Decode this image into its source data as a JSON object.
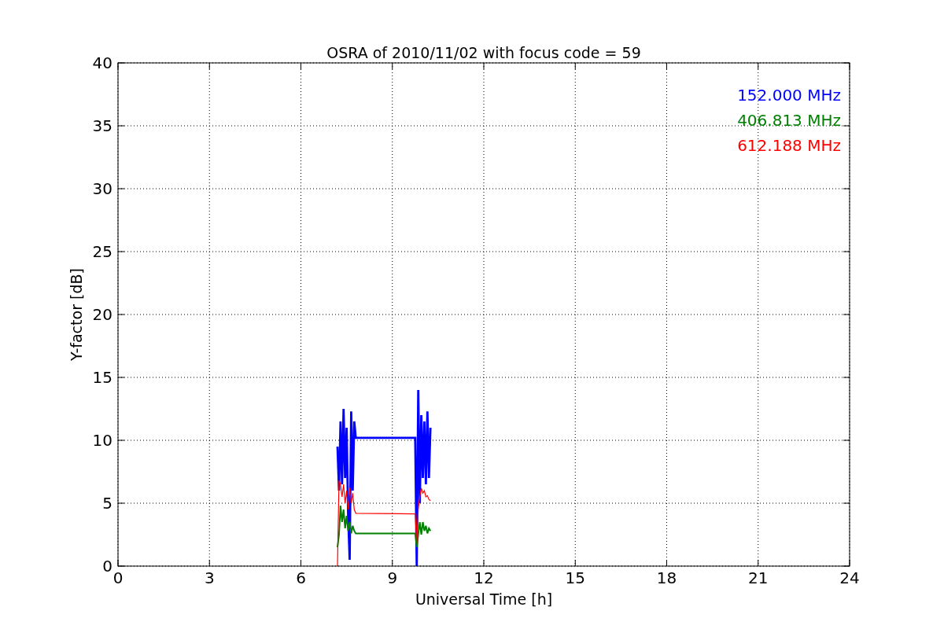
{
  "chart_data": {
    "type": "line",
    "title": "OSRA of 2010/11/02 with focus code = 59",
    "xlabel": "Universal Time [h]",
    "ylabel": "Y-factor [dB]",
    "x": [
      7.2,
      7.25,
      7.3,
      7.35,
      7.4,
      7.45,
      7.5,
      7.55,
      7.6,
      7.65,
      7.7,
      7.75,
      7.8,
      9.75,
      9.8,
      9.85,
      9.9,
      9.95,
      10.0,
      10.05,
      10.1,
      10.15,
      10.2,
      10.25
    ],
    "series": [
      {
        "name": "152.000 MHz",
        "color": "#0000ff",
        "values": [
          9.5,
          6,
          11.5,
          6.5,
          12.5,
          7,
          11,
          4,
          0.5,
          12.3,
          6,
          11.5,
          10.2,
          10.2,
          0,
          14,
          5,
          12,
          7,
          11.5,
          6.5,
          12.3,
          7,
          11
        ]
      },
      {
        "name": "406.813 MHz",
        "color": "#008000",
        "values": [
          1.5,
          2.5,
          4.8,
          3.5,
          4.5,
          3.0,
          4.0,
          2.8,
          3.5,
          2.6,
          3.2,
          2.8,
          2.6,
          2.6,
          1.5,
          2.5,
          3.5,
          2.5,
          3.5,
          2.8,
          3.2,
          2.6,
          3.0,
          2.8
        ]
      },
      {
        "name": "612.188 MHz",
        "color": "#ff0000",
        "values": [
          0,
          6.8,
          6.5,
          5.5,
          6.5,
          5.0,
          6.0,
          4.5,
          6.2,
          5.0,
          5.8,
          4.5,
          4.2,
          4.15,
          1.8,
          4.5,
          5.5,
          6.2,
          5.8,
          6.0,
          5.5,
          5.6,
          5.3,
          5.2
        ]
      }
    ],
    "grid": true,
    "xlim": [
      0,
      24
    ],
    "ylim": [
      0,
      40
    ],
    "xticks": [
      0,
      3,
      6,
      9,
      12,
      15,
      18,
      21,
      24
    ],
    "yticks": [
      0,
      5,
      10,
      15,
      20,
      25,
      30,
      35,
      40
    ]
  }
}
